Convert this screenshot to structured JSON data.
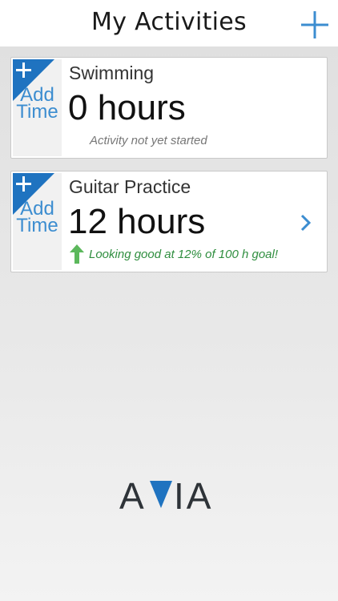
{
  "header": {
    "title": "My Activities",
    "add_icon": "plus-icon"
  },
  "activities": [
    {
      "add_time_label_1": "Add",
      "add_time_label_2": "Time",
      "name": "Swimming",
      "hours": "0 hours",
      "status": "Activity not yet started",
      "status_type": "neutral"
    },
    {
      "add_time_label_1": "Add",
      "add_time_label_2": "Time",
      "name": "Guitar Practice",
      "hours": "12 hours",
      "status": "Looking good at 12% of 100 h goal!",
      "status_type": "good",
      "progress_percent": 12,
      "goal_hours": 100
    }
  ],
  "logo": {
    "text_left": "A",
    "text_right": "IA"
  },
  "colors": {
    "accent": "#3c8dd0",
    "corner_blue": "#1f73c0",
    "good_green": "#2f8e3f",
    "arrow_green": "#5cb85c"
  }
}
